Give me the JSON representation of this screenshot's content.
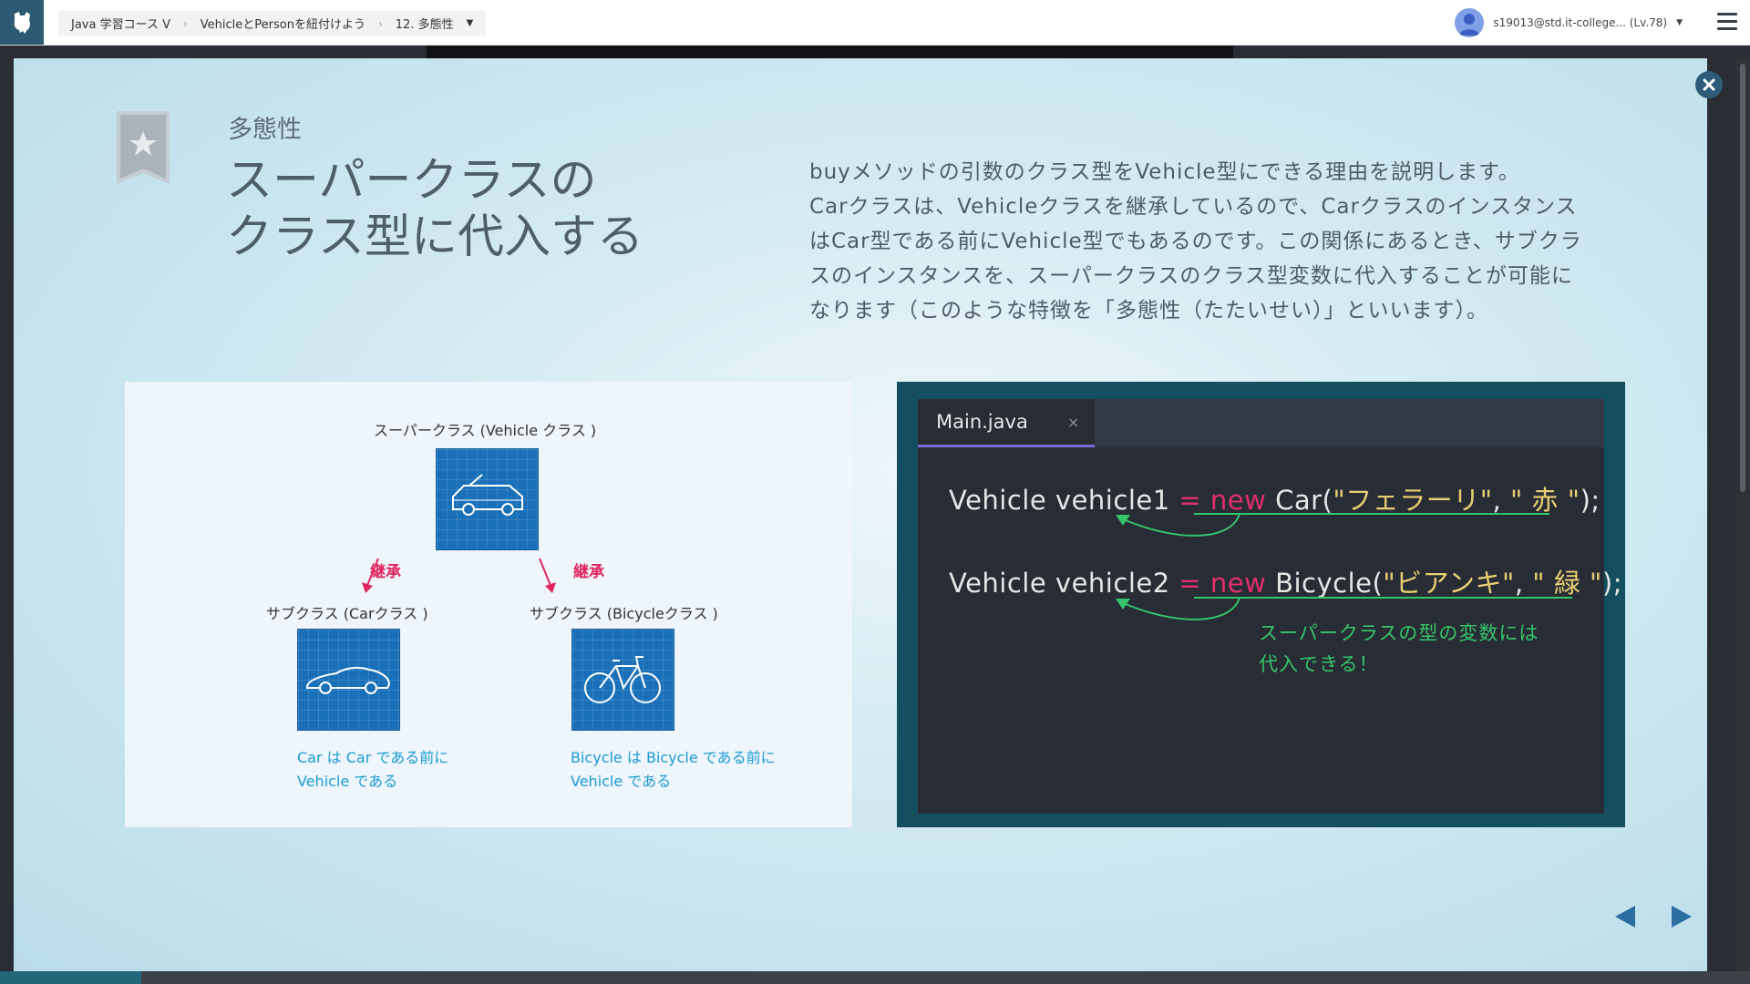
{
  "breadcrumb": {
    "course": "Java 学習コース Ⅴ",
    "lesson": "VehicleとPersonを紐付けよう",
    "slide": "12. 多態性"
  },
  "user": {
    "email": "s19013@std.it-college... (Lv.78)"
  },
  "slide": {
    "subtitle": "多態性",
    "title_line1": "スーパークラスの",
    "title_line2": "クラス型に代入する",
    "description": [
      "buyメソッドの引数のクラス型をVehicle型にできる理由を説明します。",
      "Carクラスは、Vehicleクラスを継承しているので、Carクラスのインスタンス",
      "はCar型である前にVehicle型でもあるのです。この関係にあるとき、サブクラ",
      "スのインスタンスを、スーパークラスのクラス型変数に代入することが可能に",
      "なります（このような特徴を「多態性（たたいせい）」といいます）。"
    ]
  },
  "diagram": {
    "super_label": "スーパークラス (Vehicle クラス )",
    "inherit_left": "継承",
    "inherit_right": "継承",
    "sub_car_label": "サブクラス (Carクラス )",
    "sub_bicycle_label": "サブクラス (Bicycleクラス )",
    "car_note_1": "Car は Car である前に",
    "car_note_2": "Vehicle である",
    "bicycle_note_1": "Bicycle は Bicycle である前に",
    "bicycle_note_2": "Vehicle である"
  },
  "code": {
    "tab_label": "Main.java",
    "tab_close": "×",
    "line1": {
      "decl": "Vehicle vehicle1 ",
      "op": "=",
      "kw": "new",
      "ctor": "Car(",
      "s1": "\"フェラーリ\"",
      "comma": ", ",
      "s2": "\" 赤 \"",
      "end": ");"
    },
    "line2": {
      "decl": "Vehicle vehicle2 ",
      "op": "=",
      "kw": "new",
      "ctor": "Bicycle(",
      "s1": "\"ビアンキ\"",
      "comma": ", ",
      "s2": "\" 緑 \"",
      "end": ");"
    },
    "note_line1": "スーパークラスの型の変数には",
    "note_line2": "代入できる！"
  },
  "colors": {
    "accent_pink": "#e02f6b",
    "accent_green": "#36c46b",
    "string_yellow": "#e9cf73",
    "blueprint": "#1a70b8",
    "note_blue": "#1a9bd3"
  }
}
